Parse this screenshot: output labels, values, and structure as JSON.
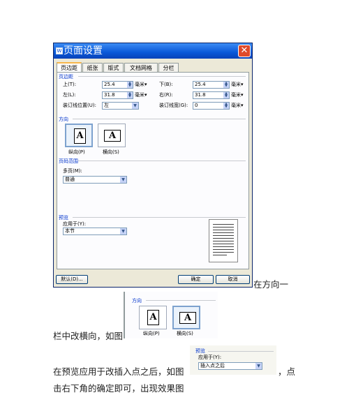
{
  "dialog": {
    "title": "页面设置",
    "close": "✕",
    "tabs": [
      "页边距",
      "纸张",
      "版式",
      "文档网格",
      "分栏"
    ],
    "margins_section": "页边距",
    "top_label": "上(T):",
    "top_value": "25.4",
    "bottom_label": "下(B):",
    "bottom_value": "25.4",
    "left_label": "左(L):",
    "left_value": "31.8",
    "right_label": "右(R):",
    "right_value": "31.8",
    "gutter_pos_label": "装订线位置(U):",
    "gutter_pos_value": "左",
    "gutter_label": "装订线宽(G):",
    "gutter_value": "0",
    "unit": "毫米",
    "orientation_section": "方向",
    "portrait_label": "纵向(P)",
    "landscape_label": "横向(S)",
    "page_range_section": "页码范围",
    "multiple_pages_label": "多页(M):",
    "multiple_pages_value": "普通",
    "preview_section": "预览",
    "apply_to_label": "应用于(Y):",
    "apply_to_value": "本节",
    "default_button": "默认(D)...",
    "ok_button": "确定",
    "cancel_button": "取消"
  },
  "snippet_orientation": {
    "section": "方向",
    "portrait_label": "纵向(P)",
    "landscape_label": "横向(S)"
  },
  "snippet_preview": {
    "section": "预览",
    "apply_to_label": "应用于(Y):",
    "apply_to_value": "插入点之后"
  },
  "text": {
    "line1": "在方向一",
    "line2": "栏中改横向，如图",
    "line3a": "在预览应用于改插入点之后，如图",
    "line3b": "，点",
    "line4": "击右下角的确定即可，出现效果图"
  }
}
